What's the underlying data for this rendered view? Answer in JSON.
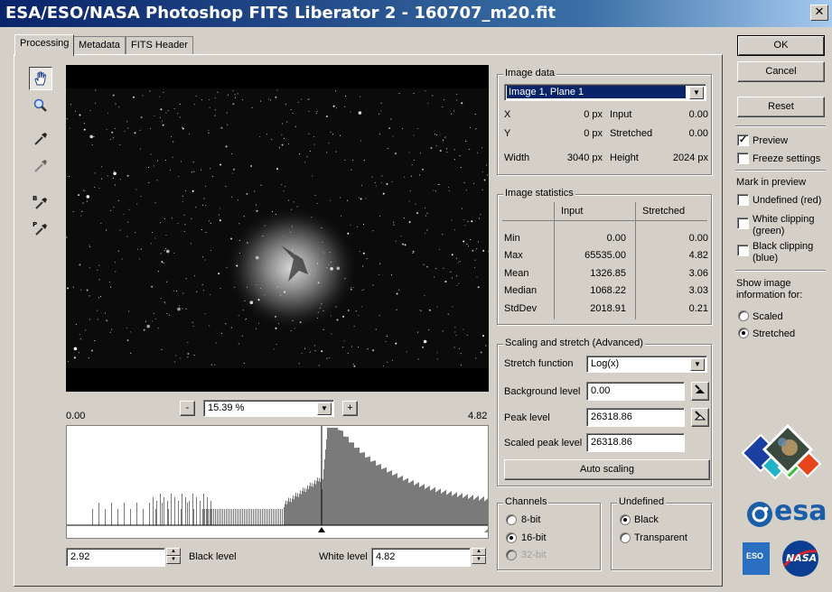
{
  "window": {
    "title": "ESA/ESO/NASA Photoshop FITS Liberator 2 - 160707_m20.fit",
    "close": "✕"
  },
  "tabs": [
    "Processing",
    "Metadata",
    "FITS Header"
  ],
  "zoom": {
    "minus": "-",
    "plus": "+",
    "value": "15.39 %"
  },
  "histogram": {
    "min_label": "0.00",
    "max_label": "4.82"
  },
  "levels": {
    "black_value": "2.92",
    "black_label": "Black level",
    "white_label": "White level",
    "white_value": "4.82"
  },
  "image_data": {
    "title": "Image data",
    "plane": "Image 1, Plane 1",
    "x_label": "X",
    "x_value": "0 px",
    "input_label": "Input",
    "input_value": "0.00",
    "y_label": "Y",
    "y_value": "0 px",
    "stretched_label": "Stretched",
    "stretched_value": "0.00",
    "width_label": "Width",
    "width_value": "3040 px",
    "height_label": "Height",
    "height_value": "2024 px"
  },
  "stats": {
    "title": "Image statistics",
    "col_input": "Input",
    "col_stretched": "Stretched",
    "rows": [
      {
        "label": "Min",
        "input": "0.00",
        "stretched": "0.00"
      },
      {
        "label": "Max",
        "input": "65535.00",
        "stretched": "4.82"
      },
      {
        "label": "Mean",
        "input": "1326.85",
        "stretched": "3.06"
      },
      {
        "label": "Median",
        "input": "1068.22",
        "stretched": "3.03"
      },
      {
        "label": "StdDev",
        "input": "2018.91",
        "stretched": "0.21"
      }
    ]
  },
  "scaling": {
    "title": "Scaling and stretch (Advanced)",
    "stretch_label": "Stretch function",
    "stretch_value": "Log(x)",
    "bg_label": "Background level",
    "bg_value": "0.00",
    "peak_label": "Peak level",
    "peak_value": "26318.86",
    "scaled_label": "Scaled peak level",
    "scaled_value": "26318.86",
    "auto": "Auto scaling"
  },
  "channels": {
    "title": "Channels",
    "opt1": "8-bit",
    "opt2": "16-bit",
    "opt3": "32-bit"
  },
  "undefined": {
    "title": "Undefined",
    "opt1": "Black",
    "opt2": "Transparent"
  },
  "buttons": {
    "ok": "OK",
    "cancel": "Cancel",
    "reset": "Reset"
  },
  "options": {
    "preview": "Preview",
    "freeze": "Freeze settings",
    "mark_title": "Mark in preview",
    "undef": "Undefined (red)",
    "white1": "White clipping",
    "white2": "(green)",
    "black1": "Black clipping",
    "black2": "(blue)",
    "show1": "Show image",
    "show2": "information for:",
    "scaled": "Scaled",
    "stretched": "Stretched"
  },
  "logos": {
    "esa": "esa",
    "nasa": "NASA",
    "eso": "ESO"
  },
  "colors": {
    "titlebar": "#0a246a",
    "selection": "#0a246a",
    "esa_blue": "#1b5ea8"
  }
}
